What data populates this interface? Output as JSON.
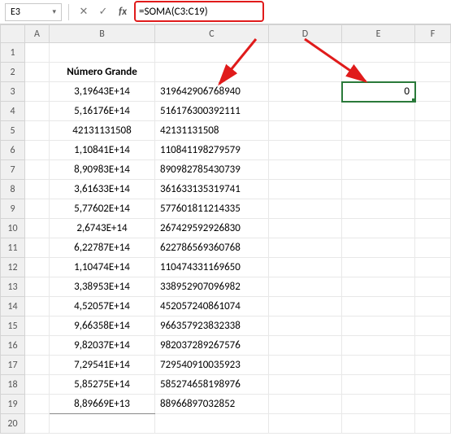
{
  "name_box": "E3",
  "formula": "=SOMA(C3:C19)",
  "columns": [
    "A",
    "B",
    "C",
    "D",
    "E",
    "F"
  ],
  "header_label": "Número Grande",
  "rows": [
    {
      "n": 1
    },
    {
      "n": 2,
      "b_header": true
    },
    {
      "n": 3,
      "b": "3,19643E+14",
      "c": "319642906768940",
      "e": "0"
    },
    {
      "n": 4,
      "b": "5,16176E+14",
      "c": "516176300392111"
    },
    {
      "n": 5,
      "b": "42131131508",
      "c": "42131131508"
    },
    {
      "n": 6,
      "b": "1,10841E+14",
      "c": "110841198279579"
    },
    {
      "n": 7,
      "b": "8,90983E+14",
      "c": "890982785430739"
    },
    {
      "n": 8,
      "b": "3,61633E+14",
      "c": "361633135319741"
    },
    {
      "n": 9,
      "b": "5,77602E+14",
      "c": "577601811214335"
    },
    {
      "n": 10,
      "b": "2,6743E+14",
      "c": "267429592926830"
    },
    {
      "n": 11,
      "b": "6,22787E+14",
      "c": "622786569360768"
    },
    {
      "n": 12,
      "b": "1,10474E+14",
      "c": "110474331169650"
    },
    {
      "n": 13,
      "b": "3,38953E+14",
      "c": "338952907096982"
    },
    {
      "n": 14,
      "b": "4,52057E+14",
      "c": "452057240861074"
    },
    {
      "n": 15,
      "b": "9,66358E+14",
      "c": "966357923832338"
    },
    {
      "n": 16,
      "b": "9,82037E+14",
      "c": "982037289267576"
    },
    {
      "n": 17,
      "b": "7,29541E+14",
      "c": "729540910035923"
    },
    {
      "n": 18,
      "b": "5,85275E+14",
      "c": "585274658198976"
    },
    {
      "n": 19,
      "b": "8,89669E+13",
      "c": "88966897032852"
    },
    {
      "n": 20
    }
  ],
  "annotations": {
    "highlight_color": "#e01b1b"
  }
}
